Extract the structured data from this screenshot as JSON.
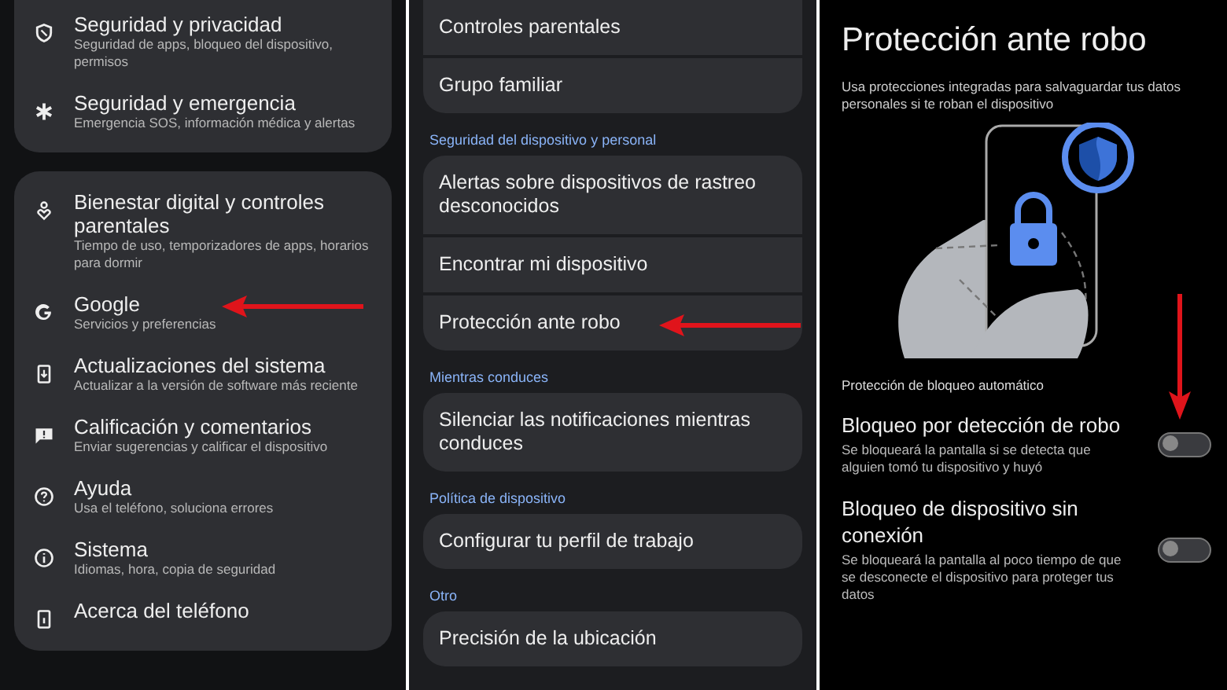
{
  "settings_list": {
    "groups": [
      {
        "items": [
          {
            "title": "Seguridad y privacidad",
            "subtitle": "Seguridad de apps, bloqueo del dispositivo, permisos",
            "marked": false
          },
          {
            "title": "Seguridad y emergencia",
            "subtitle": "Emergencia SOS, información médica y alertas",
            "marked": false
          }
        ]
      },
      {
        "items": [
          {
            "title": "Bienestar digital y controles parentales",
            "subtitle": "Tiempo de uso, temporizadores de apps, horarios para dormir",
            "marked": false
          },
          {
            "title": "Google",
            "subtitle": "Servicios y preferencias",
            "marked": true
          },
          {
            "title": "Actualizaciones del sistema",
            "subtitle": "Actualizar a la versión de software más reciente",
            "marked": false
          },
          {
            "title": "Calificación y comentarios",
            "subtitle": "Enviar sugerencias y calificar el dispositivo",
            "marked": false
          },
          {
            "title": "Ayuda",
            "subtitle": "Usa el teléfono, soluciona errores",
            "marked": false
          },
          {
            "title": "Sistema",
            "subtitle": "Idiomas, hora, copia de seguridad",
            "marked": false
          },
          {
            "title": "Acerca del teléfono",
            "marked": false
          }
        ]
      }
    ]
  },
  "safety_menu": {
    "sections": [
      {
        "items": [
          {
            "label": "Controles parentales",
            "marked": false
          },
          {
            "label": "Grupo familiar",
            "marked": false
          }
        ]
      },
      {
        "header": "Seguridad del dispositivo y personal",
        "items": [
          {
            "label": "Alertas sobre dispositivos de rastreo desconocidos",
            "marked": false
          },
          {
            "label": "Encontrar mi dispositivo",
            "marked": false
          },
          {
            "label": "Protección ante robo",
            "marked": true
          }
        ]
      },
      {
        "header": "Mientras conduces",
        "items": [
          {
            "label": "Silenciar las notificaciones mientras conduces",
            "marked": false
          }
        ]
      },
      {
        "header": "Política de dispositivo",
        "items": [
          {
            "label": "Configurar tu perfil de trabajo",
            "marked": false
          }
        ]
      },
      {
        "header": "Otro",
        "items": [
          {
            "label": "Precisión de la ubicación",
            "marked": false
          }
        ]
      }
    ]
  },
  "theft_protection": {
    "title": "Protección ante robo",
    "description": "Usa protecciones integradas para salvaguardar tus datos personales si te roban el dispositivo",
    "section_label": "Protección de bloqueo automático",
    "toggles": [
      {
        "title": "Bloqueo por detección de robo",
        "description": "Se bloqueará la pantalla si se detecta que alguien tomó tu dispositivo y huyó",
        "on": false,
        "marked": true
      },
      {
        "title": "Bloqueo de dispositivo sin conexión",
        "description": "Se bloqueará la pantalla al poco tiempo de que se desconecte el dispositivo para proteger tus datos",
        "on": false,
        "marked": false
      }
    ]
  }
}
